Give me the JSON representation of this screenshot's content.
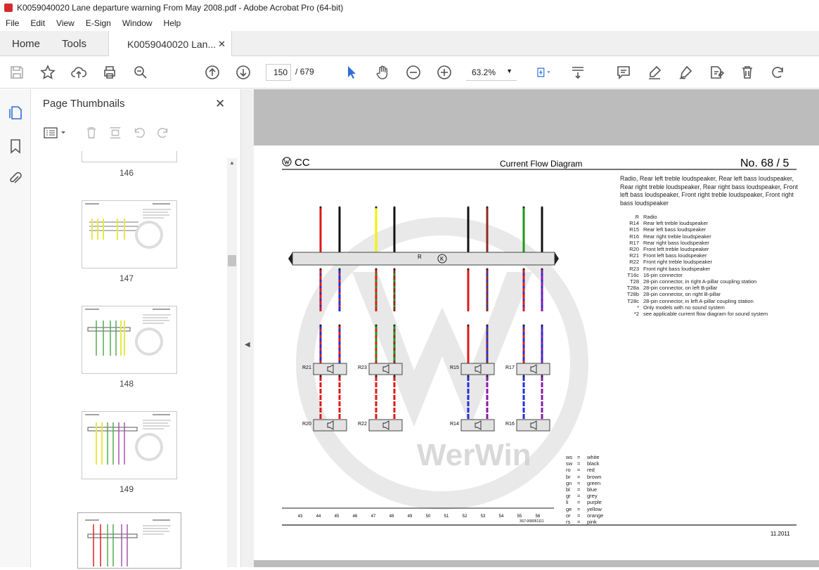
{
  "window": {
    "title": "K0059040020 Lane departure warning From May 2008.pdf - Adobe Acrobat Pro (64-bit)"
  },
  "menu": [
    "File",
    "Edit",
    "View",
    "E-Sign",
    "Window",
    "Help"
  ],
  "tabs": {
    "home": "Home",
    "tools": "Tools",
    "doc": "K0059040020 Lan..."
  },
  "toolbar": {
    "page_current": "150",
    "page_sep": "/",
    "page_total": "679",
    "zoom": "63.2%"
  },
  "thumbs": {
    "title": "Page Thumbnails",
    "pages": [
      "146",
      "147",
      "148",
      "149"
    ]
  },
  "doc": {
    "brand": "CC",
    "heading": "Current Flow Diagram",
    "number": "No.  68 / 5",
    "description": "Radio, Rear left treble loudspeaker, Rear left bass loudspeaker, Rear right treble loudspeaker, Rear right bass loudspeaker, Front left bass loudspeaker, Front right treble loudspeaker, Front right bass loudspeaker",
    "components": [
      [
        "R",
        "Radio"
      ],
      [
        "R14",
        "Rear left treble loudspeaker"
      ],
      [
        "R15",
        "Rear left bass loudspeaker"
      ],
      [
        "R16",
        "Rear right treble loudspeaker"
      ],
      [
        "R17",
        "Rear right bass loudspeaker"
      ],
      [
        "R20",
        "Front left treble loudspeaker"
      ],
      [
        "R21",
        "Front left bass loudspeaker"
      ],
      [
        "R22",
        "Front right treble loudspeaker"
      ],
      [
        "R23",
        "Front right bass loudspeaker"
      ],
      [
        "T16c",
        "16-pin connector"
      ],
      [
        "T28",
        "28-pin connector, in right A-pillar coupling station"
      ],
      [
        "T28a",
        "28-pin connector, on left B-pillar"
      ],
      [
        "T28b",
        "28-pin connector, on right B-pillar"
      ],
      [
        "T28c",
        "28-pin connector, in left A-pillar coupling station"
      ],
      [
        "*",
        "Only models with no sound system"
      ],
      [
        "*2",
        "see applicable current flow diagram for sound system"
      ]
    ],
    "colors": [
      [
        "ws",
        "white"
      ],
      [
        "sw",
        "black"
      ],
      [
        "ro",
        "red"
      ],
      [
        "br",
        "brown"
      ],
      [
        "gn",
        "green"
      ],
      [
        "bl",
        "blue"
      ],
      [
        "gr",
        "grey"
      ],
      [
        "li",
        "purple"
      ],
      [
        "ge",
        "yellow"
      ],
      [
        "or",
        "orange"
      ],
      [
        "rs",
        "pink"
      ]
    ],
    "radio_label": "R",
    "radio_symbol": "K",
    "speakers_top": [
      "R21",
      "R23",
      "R15",
      "R17"
    ],
    "speakers_bottom": [
      "R20",
      "R22",
      "R14",
      "R16"
    ],
    "column_numbers": [
      "43",
      "44",
      "45",
      "46",
      "47",
      "48",
      "49",
      "50",
      "51",
      "52",
      "53",
      "54",
      "55",
      "56"
    ],
    "part_number": "3S7-068051111",
    "date": "11.2011",
    "watermark": "WerWin",
    "wire_colors": {
      "black": "#111111",
      "yellow": "#f2f200",
      "brown": "#8b2a22",
      "green": "#1a9a1a",
      "red": "#e01818",
      "blue": "#2030d8",
      "purple": "#8a1aa8"
    }
  }
}
